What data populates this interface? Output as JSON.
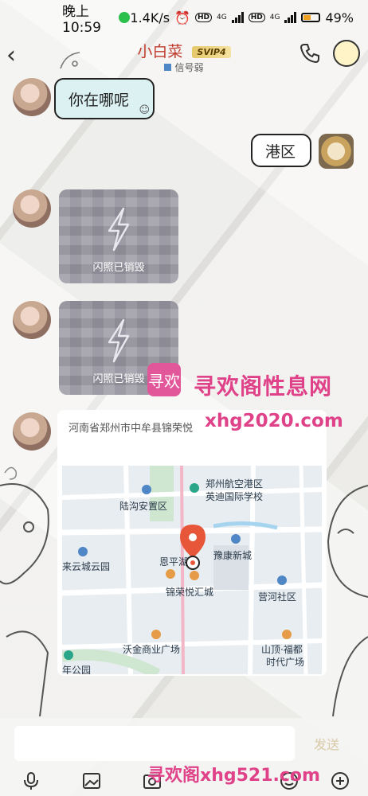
{
  "status_bar": {
    "time": "晚上10:59",
    "net_speed": "1.4K/s",
    "hd1": "HD",
    "net1": "4G",
    "hd2": "HD",
    "net2": "4G",
    "battery": "49%"
  },
  "header": {
    "back_icon": "chevron-left-icon",
    "name": "小白菜",
    "vip": "SVIP4",
    "subtitle": "信号弱"
  },
  "messages": [
    {
      "side": "in",
      "text": "你在哪呢"
    },
    {
      "side": "out",
      "text": "港区"
    },
    {
      "side": "in",
      "type": "flash",
      "label": "闪照已销毁"
    },
    {
      "side": "in",
      "type": "flash",
      "label": "闪照已销毁"
    },
    {
      "side": "in",
      "type": "location",
      "address": "河南省郑州市中牟县锦荣悦"
    }
  ],
  "map": {
    "labels": [
      "郑州航空港区",
      "英迪国际学校",
      "陆沟安置区",
      "豫康新城",
      "恩平湖",
      "来云城云园",
      "锦荣悦汇城",
      "营河社区",
      "沃金商业广场",
      "山顶·福都",
      "时代广场",
      "年公园"
    ]
  },
  "watermarks": {
    "logo_text": "寻欢",
    "top_cn": "寻欢阁性息网",
    "top_url": "xhg2020.com",
    "bottom": "寻欢阁xhg521.com"
  },
  "input": {
    "placeholder": "",
    "send_label": "发送"
  },
  "colors": {
    "title": "#c0392b",
    "bubble_in": "#dbf1f2",
    "watermark": "#e0428a",
    "pin": "#e8563a"
  }
}
